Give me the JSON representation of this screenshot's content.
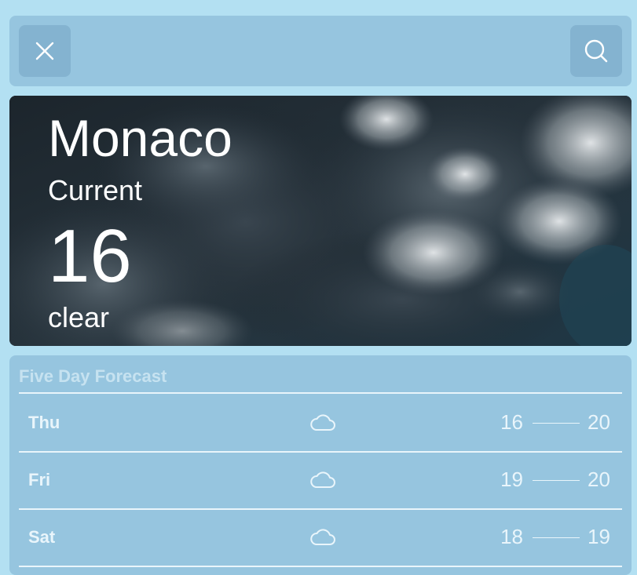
{
  "toolbar": {
    "close_icon": "close-icon",
    "search_icon": "search-icon"
  },
  "current": {
    "city": "Monaco",
    "label": "Current",
    "temperature": "16",
    "condition": "clear"
  },
  "forecast": {
    "title": "Five Day Forecast",
    "days": [
      {
        "day": "Thu",
        "icon": "cloud-icon",
        "low": "16",
        "high": "20"
      },
      {
        "day": "Fri",
        "icon": "cloud-icon",
        "low": "19",
        "high": "20"
      },
      {
        "day": "Sat",
        "icon": "cloud-icon",
        "low": "18",
        "high": "19"
      }
    ]
  },
  "colors": {
    "page_bg": "#b3e0f2",
    "panel_bg": "#96c5df",
    "button_bg": "#84b3d0",
    "text_light": "#e9f5fb"
  }
}
